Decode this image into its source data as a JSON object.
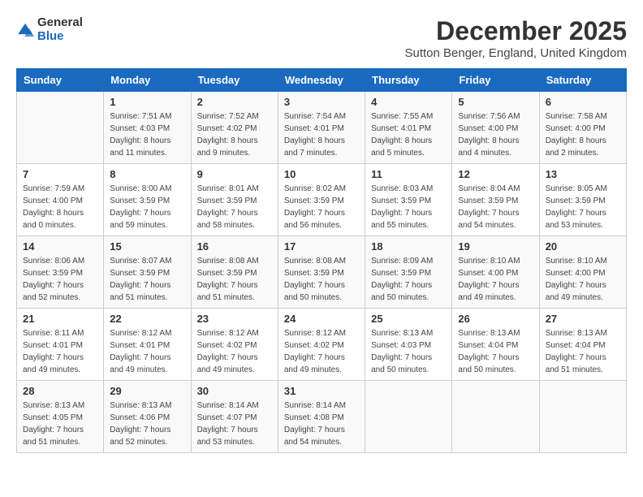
{
  "logo": {
    "text_general": "General",
    "text_blue": "Blue"
  },
  "header": {
    "month": "December 2025",
    "location": "Sutton Benger, England, United Kingdom"
  },
  "weekdays": [
    "Sunday",
    "Monday",
    "Tuesday",
    "Wednesday",
    "Thursday",
    "Friday",
    "Saturday"
  ],
  "weeks": [
    [
      {
        "day": "",
        "sunrise": "",
        "sunset": "",
        "daylight": ""
      },
      {
        "day": "1",
        "sunrise": "Sunrise: 7:51 AM",
        "sunset": "Sunset: 4:03 PM",
        "daylight": "Daylight: 8 hours and 11 minutes."
      },
      {
        "day": "2",
        "sunrise": "Sunrise: 7:52 AM",
        "sunset": "Sunset: 4:02 PM",
        "daylight": "Daylight: 8 hours and 9 minutes."
      },
      {
        "day": "3",
        "sunrise": "Sunrise: 7:54 AM",
        "sunset": "Sunset: 4:01 PM",
        "daylight": "Daylight: 8 hours and 7 minutes."
      },
      {
        "day": "4",
        "sunrise": "Sunrise: 7:55 AM",
        "sunset": "Sunset: 4:01 PM",
        "daylight": "Daylight: 8 hours and 5 minutes."
      },
      {
        "day": "5",
        "sunrise": "Sunrise: 7:56 AM",
        "sunset": "Sunset: 4:00 PM",
        "daylight": "Daylight: 8 hours and 4 minutes."
      },
      {
        "day": "6",
        "sunrise": "Sunrise: 7:58 AM",
        "sunset": "Sunset: 4:00 PM",
        "daylight": "Daylight: 8 hours and 2 minutes."
      }
    ],
    [
      {
        "day": "7",
        "sunrise": "Sunrise: 7:59 AM",
        "sunset": "Sunset: 4:00 PM",
        "daylight": "Daylight: 8 hours and 0 minutes."
      },
      {
        "day": "8",
        "sunrise": "Sunrise: 8:00 AM",
        "sunset": "Sunset: 3:59 PM",
        "daylight": "Daylight: 7 hours and 59 minutes."
      },
      {
        "day": "9",
        "sunrise": "Sunrise: 8:01 AM",
        "sunset": "Sunset: 3:59 PM",
        "daylight": "Daylight: 7 hours and 58 minutes."
      },
      {
        "day": "10",
        "sunrise": "Sunrise: 8:02 AM",
        "sunset": "Sunset: 3:59 PM",
        "daylight": "Daylight: 7 hours and 56 minutes."
      },
      {
        "day": "11",
        "sunrise": "Sunrise: 8:03 AM",
        "sunset": "Sunset: 3:59 PM",
        "daylight": "Daylight: 7 hours and 55 minutes."
      },
      {
        "day": "12",
        "sunrise": "Sunrise: 8:04 AM",
        "sunset": "Sunset: 3:59 PM",
        "daylight": "Daylight: 7 hours and 54 minutes."
      },
      {
        "day": "13",
        "sunrise": "Sunrise: 8:05 AM",
        "sunset": "Sunset: 3:59 PM",
        "daylight": "Daylight: 7 hours and 53 minutes."
      }
    ],
    [
      {
        "day": "14",
        "sunrise": "Sunrise: 8:06 AM",
        "sunset": "Sunset: 3:59 PM",
        "daylight": "Daylight: 7 hours and 52 minutes."
      },
      {
        "day": "15",
        "sunrise": "Sunrise: 8:07 AM",
        "sunset": "Sunset: 3:59 PM",
        "daylight": "Daylight: 7 hours and 51 minutes."
      },
      {
        "day": "16",
        "sunrise": "Sunrise: 8:08 AM",
        "sunset": "Sunset: 3:59 PM",
        "daylight": "Daylight: 7 hours and 51 minutes."
      },
      {
        "day": "17",
        "sunrise": "Sunrise: 8:08 AM",
        "sunset": "Sunset: 3:59 PM",
        "daylight": "Daylight: 7 hours and 50 minutes."
      },
      {
        "day": "18",
        "sunrise": "Sunrise: 8:09 AM",
        "sunset": "Sunset: 3:59 PM",
        "daylight": "Daylight: 7 hours and 50 minutes."
      },
      {
        "day": "19",
        "sunrise": "Sunrise: 8:10 AM",
        "sunset": "Sunset: 4:00 PM",
        "daylight": "Daylight: 7 hours and 49 minutes."
      },
      {
        "day": "20",
        "sunrise": "Sunrise: 8:10 AM",
        "sunset": "Sunset: 4:00 PM",
        "daylight": "Daylight: 7 hours and 49 minutes."
      }
    ],
    [
      {
        "day": "21",
        "sunrise": "Sunrise: 8:11 AM",
        "sunset": "Sunset: 4:01 PM",
        "daylight": "Daylight: 7 hours and 49 minutes."
      },
      {
        "day": "22",
        "sunrise": "Sunrise: 8:12 AM",
        "sunset": "Sunset: 4:01 PM",
        "daylight": "Daylight: 7 hours and 49 minutes."
      },
      {
        "day": "23",
        "sunrise": "Sunrise: 8:12 AM",
        "sunset": "Sunset: 4:02 PM",
        "daylight": "Daylight: 7 hours and 49 minutes."
      },
      {
        "day": "24",
        "sunrise": "Sunrise: 8:12 AM",
        "sunset": "Sunset: 4:02 PM",
        "daylight": "Daylight: 7 hours and 49 minutes."
      },
      {
        "day": "25",
        "sunrise": "Sunrise: 8:13 AM",
        "sunset": "Sunset: 4:03 PM",
        "daylight": "Daylight: 7 hours and 50 minutes."
      },
      {
        "day": "26",
        "sunrise": "Sunrise: 8:13 AM",
        "sunset": "Sunset: 4:04 PM",
        "daylight": "Daylight: 7 hours and 50 minutes."
      },
      {
        "day": "27",
        "sunrise": "Sunrise: 8:13 AM",
        "sunset": "Sunset: 4:04 PM",
        "daylight": "Daylight: 7 hours and 51 minutes."
      }
    ],
    [
      {
        "day": "28",
        "sunrise": "Sunrise: 8:13 AM",
        "sunset": "Sunset: 4:05 PM",
        "daylight": "Daylight: 7 hours and 51 minutes."
      },
      {
        "day": "29",
        "sunrise": "Sunrise: 8:13 AM",
        "sunset": "Sunset: 4:06 PM",
        "daylight": "Daylight: 7 hours and 52 minutes."
      },
      {
        "day": "30",
        "sunrise": "Sunrise: 8:14 AM",
        "sunset": "Sunset: 4:07 PM",
        "daylight": "Daylight: 7 hours and 53 minutes."
      },
      {
        "day": "31",
        "sunrise": "Sunrise: 8:14 AM",
        "sunset": "Sunset: 4:08 PM",
        "daylight": "Daylight: 7 hours and 54 minutes."
      },
      {
        "day": "",
        "sunrise": "",
        "sunset": "",
        "daylight": ""
      },
      {
        "day": "",
        "sunrise": "",
        "sunset": "",
        "daylight": ""
      },
      {
        "day": "",
        "sunrise": "",
        "sunset": "",
        "daylight": ""
      }
    ]
  ]
}
